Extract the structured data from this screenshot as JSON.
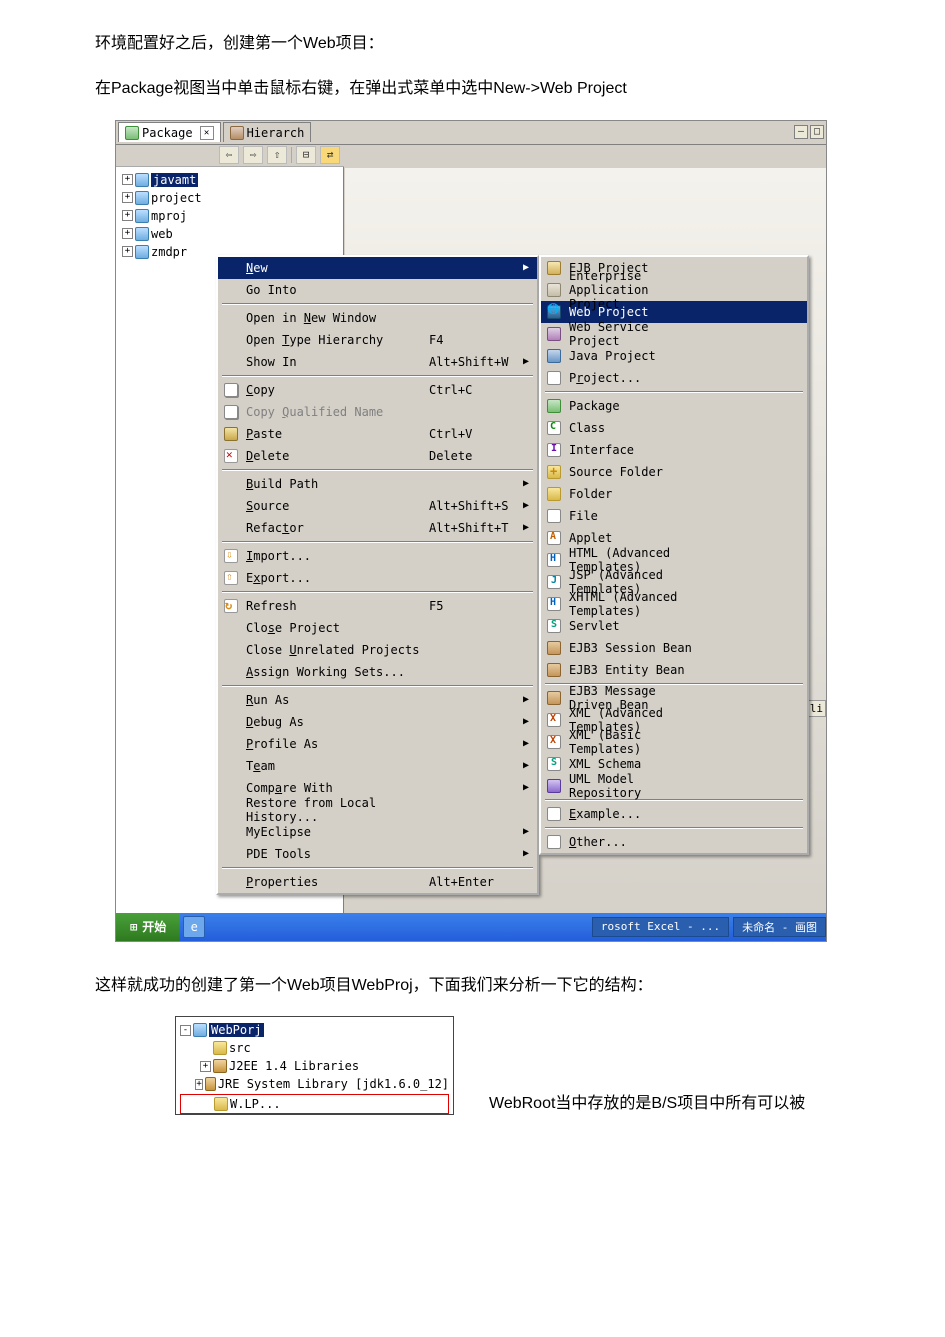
{
  "doc": {
    "p1": "环境配置好之后，创建第一个Web项目：",
    "p2": "在Package视图当中单击鼠标右键，在弹出式菜单中选中New->Web Project",
    "p3": "这样就成功的创建了第一个Web项目WebProj，下面我们来分析一下它的结构：",
    "p4": "WebRoot当中存放的是B/S项目中所有可以被"
  },
  "views": {
    "tab1": "Package",
    "tab1_close": "✕",
    "tab2": "Hierarch",
    "min_glyph": "—",
    "max_glyph": "□"
  },
  "toolbar": {
    "back": "⇦",
    "fwd": "⇨",
    "up": "⇧",
    "collapse": "⊟",
    "link": "⇄"
  },
  "tree": {
    "items": [
      {
        "name": "javamt",
        "selected": true
      },
      {
        "name": "project"
      },
      {
        "name": "mproj"
      },
      {
        "name": "web"
      },
      {
        "name": "zmdpr"
      }
    ]
  },
  "context_menu": [
    {
      "icon": "",
      "label": "New",
      "hlchar": "N",
      "acc": "",
      "arrow": true,
      "highlight": true
    },
    {
      "icon": "",
      "label": "Go Into",
      "hlchar": "",
      "acc": "",
      "arrow": false
    },
    {
      "sep": true
    },
    {
      "icon": "",
      "label": "Open in New Window",
      "hlchar": "N",
      "acc": "",
      "arrow": false
    },
    {
      "icon": "",
      "label": "Open Type Hierarchy",
      "hlchar": "T",
      "acc": "F4",
      "arrow": false
    },
    {
      "icon": "",
      "label": "Show In",
      "hlchar": "W",
      "acc": "Alt+Shift+W",
      "arrow": true
    },
    {
      "sep": true
    },
    {
      "icon": "copy",
      "label": "Copy",
      "hlchar": "C",
      "acc": "Ctrl+C",
      "arrow": false
    },
    {
      "icon": "copy",
      "label": "Copy Qualified Name",
      "hlchar": "Q",
      "acc": "",
      "arrow": false,
      "disabled": true
    },
    {
      "icon": "paste",
      "label": "Paste",
      "hlchar": "P",
      "acc": "Ctrl+V",
      "arrow": false
    },
    {
      "icon": "del",
      "label": "Delete",
      "hlchar": "D",
      "acc": "Delete",
      "arrow": false
    },
    {
      "sep": true
    },
    {
      "icon": "",
      "label": "Build Path",
      "hlchar": "B",
      "acc": "",
      "arrow": true
    },
    {
      "icon": "",
      "label": "Source",
      "hlchar": "S",
      "acc": "Alt+Shift+S",
      "arrow": true
    },
    {
      "icon": "",
      "label": "Refactor",
      "hlchar": "t",
      "acc": "Alt+Shift+T",
      "arrow": true
    },
    {
      "sep": true
    },
    {
      "icon": "imp",
      "label": "Import...",
      "hlchar": "I",
      "acc": "",
      "arrow": false
    },
    {
      "icon": "exp",
      "label": "Export...",
      "hlchar": "x",
      "acc": "",
      "arrow": false
    },
    {
      "sep": true
    },
    {
      "icon": "ref",
      "label": "Refresh",
      "hlchar": "F",
      "acc": "F5",
      "arrow": false
    },
    {
      "icon": "",
      "label": "Close Project",
      "hlchar": "s",
      "acc": "",
      "arrow": false
    },
    {
      "icon": "",
      "label": "Close Unrelated Projects",
      "hlchar": "U",
      "acc": "",
      "arrow": false
    },
    {
      "icon": "",
      "label": "Assign Working Sets...",
      "hlchar": "A",
      "acc": "",
      "arrow": false
    },
    {
      "sep": true
    },
    {
      "icon": "",
      "label": "Run As",
      "hlchar": "R",
      "acc": "",
      "arrow": true
    },
    {
      "icon": "",
      "label": "Debug As",
      "hlchar": "D",
      "acc": "",
      "arrow": true
    },
    {
      "icon": "",
      "label": "Profile As",
      "hlchar": "P",
      "acc": "",
      "arrow": true
    },
    {
      "icon": "",
      "label": "Team",
      "hlchar": "e",
      "acc": "",
      "arrow": true
    },
    {
      "icon": "",
      "label": "Compare With",
      "hlchar": "a",
      "acc": "",
      "arrow": true
    },
    {
      "icon": "",
      "label": "Restore from Local History...",
      "hlchar": "",
      "acc": "",
      "arrow": false
    },
    {
      "icon": "",
      "label": "MyEclipse",
      "hlchar": "",
      "acc": "",
      "arrow": true
    },
    {
      "icon": "",
      "label": "PDE Tools",
      "hlchar": "",
      "acc": "",
      "arrow": true
    },
    {
      "sep": true
    },
    {
      "icon": "",
      "label": "Properties",
      "hlchar": "P",
      "acc": "Alt+Enter",
      "arrow": false
    }
  ],
  "submenu": [
    {
      "icon": "ejb",
      "label": "EJB Project"
    },
    {
      "icon": "ear",
      "label": "Enterprise Application Project"
    },
    {
      "icon": "web",
      "label": "Web Project",
      "highlight": true
    },
    {
      "icon": "ws",
      "label": "Web Service Project"
    },
    {
      "icon": "java",
      "label": "Java Project"
    },
    {
      "icon": "prjx",
      "label": "Project...",
      "hl": "r"
    },
    {
      "sep": true
    },
    {
      "icon": "pkg",
      "label": "Package"
    },
    {
      "icon": "class",
      "label": "Class"
    },
    {
      "icon": "iface",
      "label": "Interface"
    },
    {
      "icon": "sfold",
      "label": "Source Folder"
    },
    {
      "icon": "folder",
      "label": "Folder"
    },
    {
      "icon": "file",
      "label": "File"
    },
    {
      "icon": "applet",
      "label": "Applet"
    },
    {
      "icon": "html",
      "label": "HTML (Advanced Templates)"
    },
    {
      "icon": "jsp",
      "label": "JSP (Advanced Templates)"
    },
    {
      "icon": "html",
      "label": "XHTML (Advanced Templates)"
    },
    {
      "icon": "srv",
      "label": "Servlet"
    },
    {
      "icon": "bean",
      "label": "EJB3 Session Bean"
    },
    {
      "icon": "bean",
      "label": "EJB3 Entity Bean"
    },
    {
      "sep": true
    },
    {
      "icon": "bean",
      "label": "EJB3 Message Driven Bean"
    },
    {
      "icon": "xml",
      "label": "XML (Advanced Templates)"
    },
    {
      "icon": "xml",
      "label": "XML (Basic Templates)"
    },
    {
      "icon": "srv",
      "label": "XML Schema"
    },
    {
      "icon": "uml",
      "label": "UML Model Repository"
    },
    {
      "sep": true
    },
    {
      "icon": "ex",
      "label": "Example...",
      "hl": "E"
    },
    {
      "sep": true
    },
    {
      "icon": "ex",
      "label": "Other...",
      "hl": "O"
    }
  ],
  "side_label": "li",
  "taskbar": {
    "start": "开始",
    "app1": "rosoft Excel - ...",
    "app2": "未命名 - 画图"
  },
  "tree2": {
    "root": "WebPorj",
    "items": [
      {
        "icon": "folder",
        "label": "src",
        "plus": false
      },
      {
        "icon": "lib",
        "label": "J2EE 1.4 Libraries",
        "plus": true
      },
      {
        "icon": "lib",
        "label": "JRE System Library [jdk1.6.0_12]",
        "plus": true
      },
      {
        "icon": "folder",
        "label": "W.LP...",
        "plus": false,
        "red": true
      }
    ]
  }
}
